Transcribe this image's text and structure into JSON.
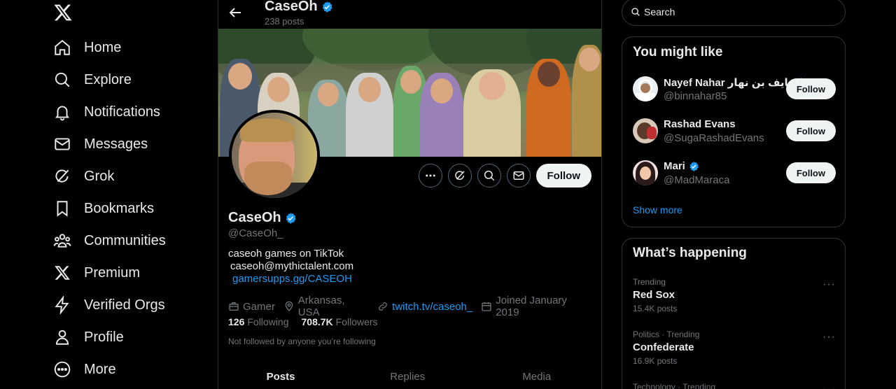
{
  "nav": {
    "items": [
      {
        "label": "Home",
        "icon": "home-icon"
      },
      {
        "label": "Explore",
        "icon": "search-icon"
      },
      {
        "label": "Notifications",
        "icon": "bell-icon"
      },
      {
        "label": "Messages",
        "icon": "envelope-icon"
      },
      {
        "label": "Grok",
        "icon": "grok-icon"
      },
      {
        "label": "Bookmarks",
        "icon": "bookmark-icon"
      },
      {
        "label": "Communities",
        "icon": "people-icon"
      },
      {
        "label": "Premium",
        "icon": "x-logo-icon"
      },
      {
        "label": "Verified Orgs",
        "icon": "lightning-icon"
      },
      {
        "label": "Profile",
        "icon": "person-icon"
      },
      {
        "label": "More",
        "icon": "more-circle-icon"
      }
    ]
  },
  "header": {
    "name": "CaseOh",
    "posts": "238 posts"
  },
  "profile": {
    "name": "CaseOh",
    "handle": "@CaseOh_",
    "bio_line1": "caseoh games on TikTok",
    "bio_line2": "caseoh@mythictalent.com",
    "bio_line3": "gamersupps.gg/CASEOH",
    "category": "Gamer",
    "location": "Arkansas, USA",
    "website": "twitch.tv/caseoh_",
    "joined": "Joined January 2019",
    "following_count": "126",
    "following_label": "Following",
    "followers_count": "708.7K",
    "followers_label": "Followers",
    "not_followed": "Not followed by anyone you’re following",
    "follow_label": "Follow"
  },
  "tabs": [
    {
      "label": "Posts",
      "active": true
    },
    {
      "label": "Replies",
      "active": false
    },
    {
      "label": "Media",
      "active": false
    }
  ],
  "search": {
    "placeholder": "Search"
  },
  "who_to_follow": {
    "title": "You might like",
    "users": [
      {
        "name": "Nayef Nahar نايف بن نهار",
        "handle": "@binnahar85",
        "verified": true,
        "button": "Follow"
      },
      {
        "name": "Rashad Evans",
        "handle": "@SugaRashadEvans",
        "verified": false,
        "button": "Follow"
      },
      {
        "name": "Mari",
        "handle": "@MadMaraca",
        "verified": true,
        "button": "Follow"
      }
    ],
    "show_more": "Show more"
  },
  "trending": {
    "title": "What’s happening",
    "items": [
      {
        "context": "Trending",
        "topic": "Red Sox",
        "posts": "15.4K posts"
      },
      {
        "context": "Politics · Trending",
        "topic": "Confederate",
        "posts": "16.9K posts"
      },
      {
        "context": "Technology · Trending",
        "topic": "",
        "posts": ""
      }
    ]
  },
  "colors": {
    "accent": "#1d9bf0",
    "verified": "#1d9bf0",
    "text": "#e7e9ea",
    "muted": "#71767b",
    "border": "#2f3336"
  }
}
